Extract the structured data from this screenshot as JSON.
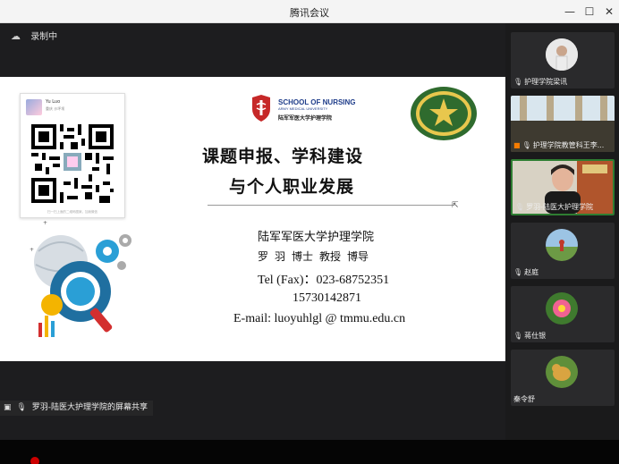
{
  "window": {
    "title": "腾讯会议",
    "btn_min": "—",
    "btn_max": "☐",
    "btn_close": "✕"
  },
  "recording": {
    "icon": "cloud-recording-icon",
    "label": "录制中"
  },
  "slide": {
    "qr_card": {
      "name": "Yu Luo",
      "location": "重庆 沙坪坝",
      "hint": "扫一扫上面的二维码图案，加我微信"
    },
    "school_en": "SCHOOL OF NURSING",
    "school_en_sub": "ARMY MEDICAL UNIVERSITY",
    "school_cn": "陆军军医大学护理学院",
    "title_line1": "课题申报、学科建设",
    "title_line2": "与个人职业发展",
    "org": "陆军军医大学护理学院",
    "person": "罗 羽 博士 教授 博导",
    "tel": "Tel (Fax)：023-68752351",
    "mobile": "15730142871",
    "email": "E-mail: luoyuhlgl @ tmmu.edu.cn"
  },
  "share_label": "罗羽-陆医大护理学院的屏幕共享",
  "participants": [
    {
      "name": "护理学院梁讯"
    },
    {
      "name": "护理学院教管科王李..."
    },
    {
      "name": "罗羽-陆医大护理学院"
    },
    {
      "name": "赵庭"
    },
    {
      "name": "蒋仕银"
    },
    {
      "name": "秦令舒"
    }
  ],
  "colors": {
    "active_border": "#2e7d32",
    "school_blue": "#1f3d8a",
    "recording_red": "#cc0000"
  }
}
